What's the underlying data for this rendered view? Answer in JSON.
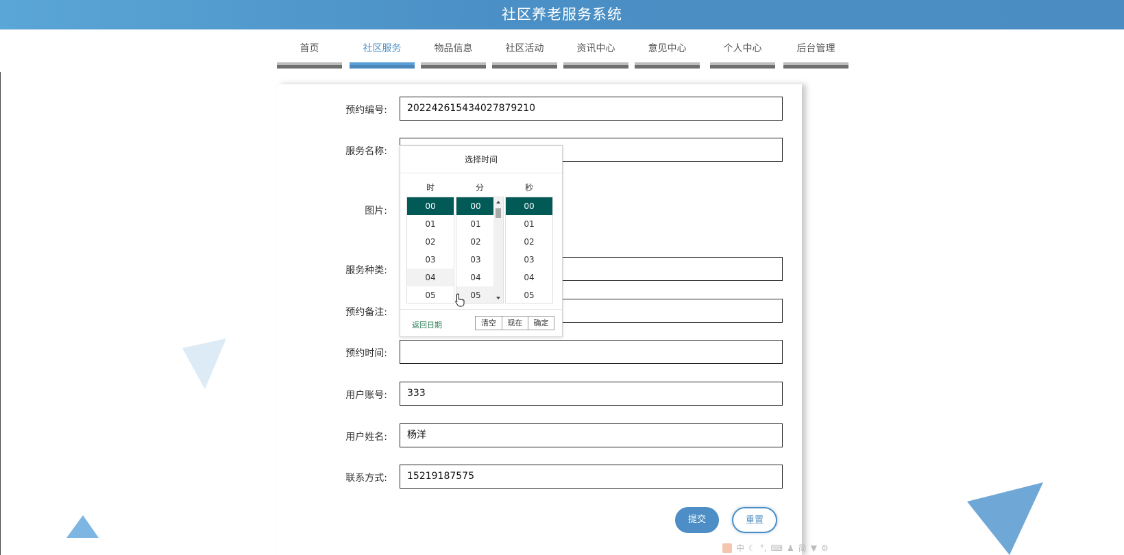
{
  "header": {
    "title": "社区养老服务系统"
  },
  "nav": {
    "items": [
      {
        "label": "首页",
        "active": false
      },
      {
        "label": "社区服务",
        "active": true
      },
      {
        "label": "物品信息",
        "active": false
      },
      {
        "label": "社区活动",
        "active": false
      },
      {
        "label": "资讯中心",
        "active": false
      },
      {
        "label": "意见中心",
        "active": false
      },
      {
        "label": "个人中心",
        "active": false
      },
      {
        "label": "后台管理",
        "active": false
      }
    ]
  },
  "form": {
    "booking_no": {
      "label": "预约编号:",
      "value": "20224261543402787921​0"
    },
    "service_name": {
      "label": "服务名称:",
      "value": ""
    },
    "image": {
      "label": "图片:"
    },
    "service_type": {
      "label": "服务种类:",
      "value": ""
    },
    "note": {
      "label": "预约备注:",
      "value": ""
    },
    "booking_time": {
      "label": "预约时间:",
      "value": ""
    },
    "account": {
      "label": "用户账号:",
      "value": "333"
    },
    "username": {
      "label": "用户姓名:",
      "value": "杨洋"
    },
    "contact": {
      "label": "联系方式:",
      "value": "15219187575"
    },
    "submit_label": "提交",
    "reset_label": "重置"
  },
  "time_picker": {
    "title": "选择时间",
    "col_hour": "时",
    "col_minute": "分",
    "col_second": "秒",
    "hours": [
      "00",
      "01",
      "02",
      "03",
      "04",
      "05"
    ],
    "minutes": [
      "00",
      "01",
      "02",
      "03",
      "04",
      "05"
    ],
    "seconds": [
      "00",
      "01",
      "02",
      "03",
      "04",
      "05"
    ],
    "selected": {
      "hour": "00",
      "minute": "00",
      "second": "00"
    },
    "back_label": "返回日期",
    "clear_label": "清空",
    "now_label": "现在",
    "confirm_label": "确定"
  },
  "tray": {
    "ime_label": "中",
    "simplified_label": "简"
  },
  "colors": {
    "header": "#4b8dc3",
    "accent": "#4c8ec5",
    "picker_selected": "#025a57",
    "deco": "#5aa6d6"
  }
}
